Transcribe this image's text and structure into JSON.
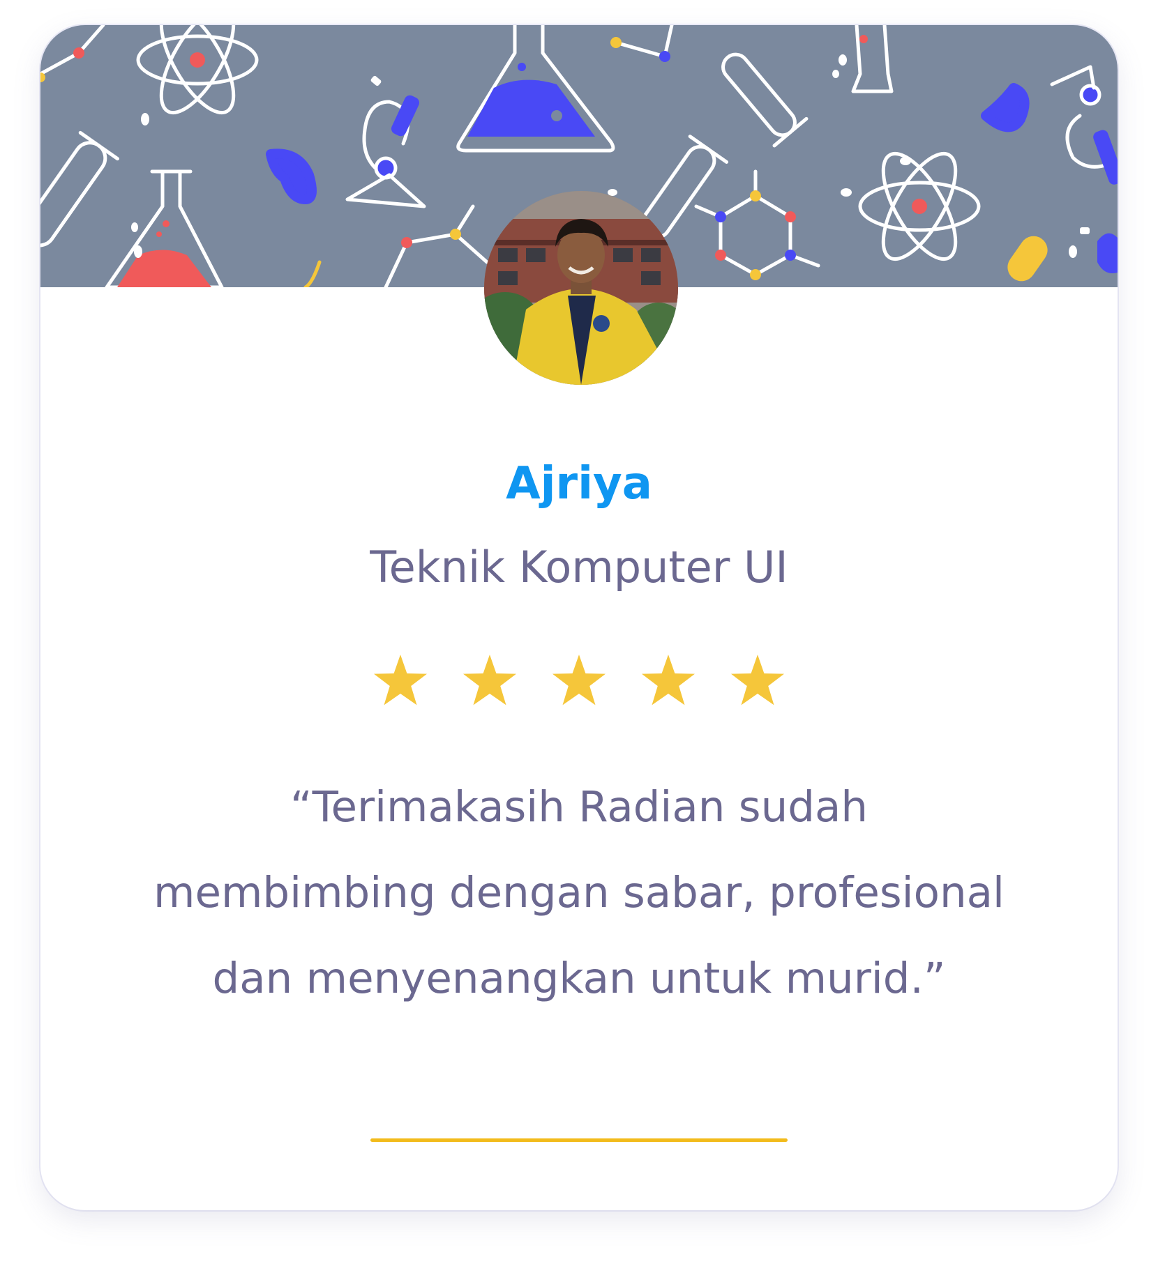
{
  "testimonial": {
    "name": "Ajriya",
    "school": "Teknik Komputer UI",
    "rating": 5,
    "rating_max": 5,
    "quote": "“Terimakasih Radian sudah membimbing dengan sabar, profesional dan menyenangkan untuk murid.”"
  },
  "colors": {
    "name": "#0f96f1",
    "text": "#6b6890",
    "star": "#f5c63a",
    "underline": "#f2bb1c",
    "banner": "#7b899e"
  },
  "icons": {
    "banner": "science-pattern-banner",
    "star": "star-icon",
    "avatar": "user-photo"
  }
}
